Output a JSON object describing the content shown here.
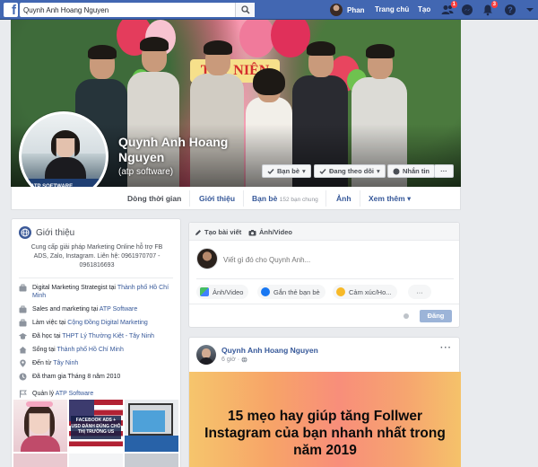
{
  "topbar": {
    "logo": "f",
    "search_value": "Quynh Anh Hoang Nguyen",
    "user_name": "Phan",
    "home_label": "Trang chủ",
    "create_label": "Tạo",
    "friend_requests_badge": "1",
    "notifications_badge": "3",
    "accent": "#4267b2"
  },
  "profile": {
    "name": "Quynh Anh Hoang Nguyen",
    "name_line1": "Quynh Anh Hoang",
    "name_line2": "Nguyen",
    "alternate_name": "(atp software)",
    "profile_pic_label": "ATP SOFTWARE",
    "buttons": {
      "friends": "Bạn bè",
      "following": "Đang theo dõi",
      "message": "Nhắn tin",
      "more": "···"
    }
  },
  "tabs": [
    {
      "label": "Dòng thời gian"
    },
    {
      "label": "Giới thiệu"
    },
    {
      "label": "Bạn bè",
      "extra": "152 bạn chung"
    },
    {
      "label": "Ảnh"
    },
    {
      "label": "Xem thêm ▾"
    }
  ],
  "intro": {
    "title": "Giới thiệu",
    "description": "Cung cấp giải pháp Marketing Online hỗ trợ FB ADS, Zalo, Instagram. Liên hệ: 0961970707 - 0961816693",
    "rows": [
      {
        "icon": "briefcase-icon",
        "text": "Digital Marketing Strategist tại ",
        "link": "Thành phố Hồ Chí Minh"
      },
      {
        "icon": "briefcase-icon",
        "text": "Sales and marketing tại ",
        "link": "ATP Software"
      },
      {
        "icon": "briefcase-icon",
        "text": "Làm việc tại ",
        "link": "Cộng Đồng Digital Marketing"
      },
      {
        "icon": "graduation-cap-icon",
        "text": "Đã học tại ",
        "link": "THPT Lý Thường Kiệt - Tây Ninh"
      },
      {
        "icon": "home-icon",
        "text": "Sống tại ",
        "link": "Thành phố Hồ Chí Minh"
      },
      {
        "icon": "location-pin-icon",
        "text": "Đến từ ",
        "link": "Tây Ninh"
      },
      {
        "icon": "clock-icon",
        "text": "Đã tham gia Tháng 8 năm 2010",
        "link": ""
      },
      {
        "icon": "flag-icon",
        "text": "Quản lý ",
        "link": "ATP Software"
      }
    ],
    "photo_captions": {
      "p2": "FACEBOOK ADS + USD ĐÁNH ĐÚNG CHỖ THỊ TRƯỜNG US"
    }
  },
  "composer": {
    "tab_post": "Tạo bài viết",
    "tab_photo": "Ảnh/Video",
    "placeholder": "Viết gì đó cho Quynh Anh...",
    "actions": [
      "Ảnh/Video",
      "Gắn thẻ bạn bè",
      "Cảm xúc/Ho..."
    ],
    "more": "···",
    "submit": "Đăng"
  },
  "post": {
    "author": "Quynh Anh Hoang Nguyen",
    "time": "6 giờ ·",
    "more": "···",
    "image_text": "15 mẹo hay giúp tăng Follwer Instagram của bạn nhanh nhất trong năm 2019"
  }
}
